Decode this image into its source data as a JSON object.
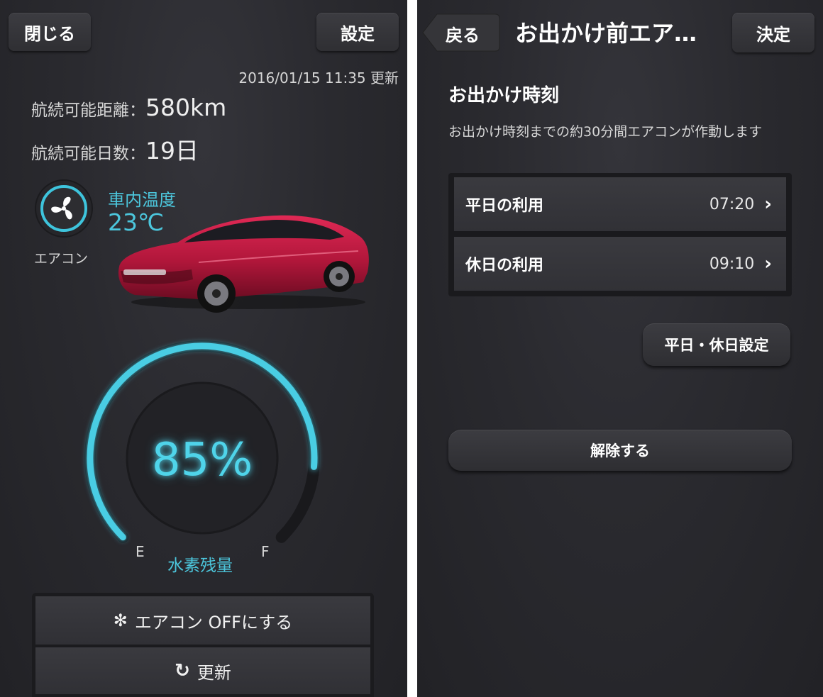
{
  "left": {
    "close_label": "閉じる",
    "settings_label": "設定",
    "updated": "2016/01/15 11:35 更新",
    "range_label": "航続可能距離：",
    "range_value": "580km",
    "days_label": "航続可能日数：",
    "days_value": "19日",
    "temp_label": "車内温度",
    "temp_value": "23℃",
    "aircon_label": "エアコン",
    "gauge": {
      "percent_text": "85%",
      "level": 0.85,
      "e_label": "E",
      "f_label": "F",
      "caption": "水素残量"
    },
    "aircon_off_label": "エアコン OFFにする",
    "refresh_label": "更新",
    "colors": {
      "accent": "#4cc6dc",
      "car": "#b0163a"
    }
  },
  "right": {
    "back_label": "戻る",
    "title": "お出かけ前エア…",
    "confirm_label": "決定",
    "section_title": "お出かけ時刻",
    "description": "お出かけ時刻までの約30分間エアコンが作動します",
    "rows": [
      {
        "label": "平日の利用",
        "time": "07:20"
      },
      {
        "label": "休日の利用",
        "time": "09:10"
      }
    ],
    "weekday_holiday_settings_label": "平日・休日設定",
    "cancel_label": "解除する"
  }
}
